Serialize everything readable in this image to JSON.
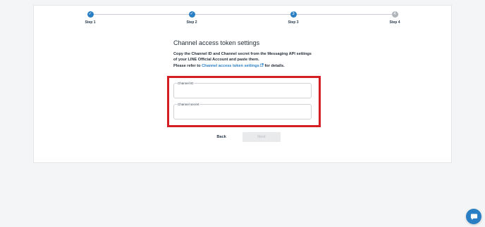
{
  "steps": [
    {
      "label": "Step 1",
      "status": "done",
      "marker": "✓"
    },
    {
      "label": "Step 2",
      "status": "done",
      "marker": "✓"
    },
    {
      "label": "Step 3",
      "status": "current",
      "marker": "3"
    },
    {
      "label": "Step 4",
      "status": "todo",
      "marker": "4"
    }
  ],
  "page": {
    "title": "Channel access token settings",
    "desc_line1": "Copy the Channel ID and Channel secret from the Messaging API settings",
    "desc_line2": "of your LINE Official Account and paste them.",
    "desc_prefix": "Please refer to ",
    "desc_link": "Channel access token settings",
    "desc_suffix": " for details."
  },
  "form": {
    "channel_id_label": "Channel ID",
    "channel_id_value": "",
    "channel_secret_label": "Channel secret",
    "channel_secret_value": ""
  },
  "buttons": {
    "back": "Back",
    "next": "Next"
  },
  "icons": {
    "external_link": "external-link-icon",
    "chat": "chat-icon"
  },
  "colors": {
    "accent": "#2a7fc4",
    "highlight": "#d51e24",
    "step_todo": "#b0b5bb"
  }
}
